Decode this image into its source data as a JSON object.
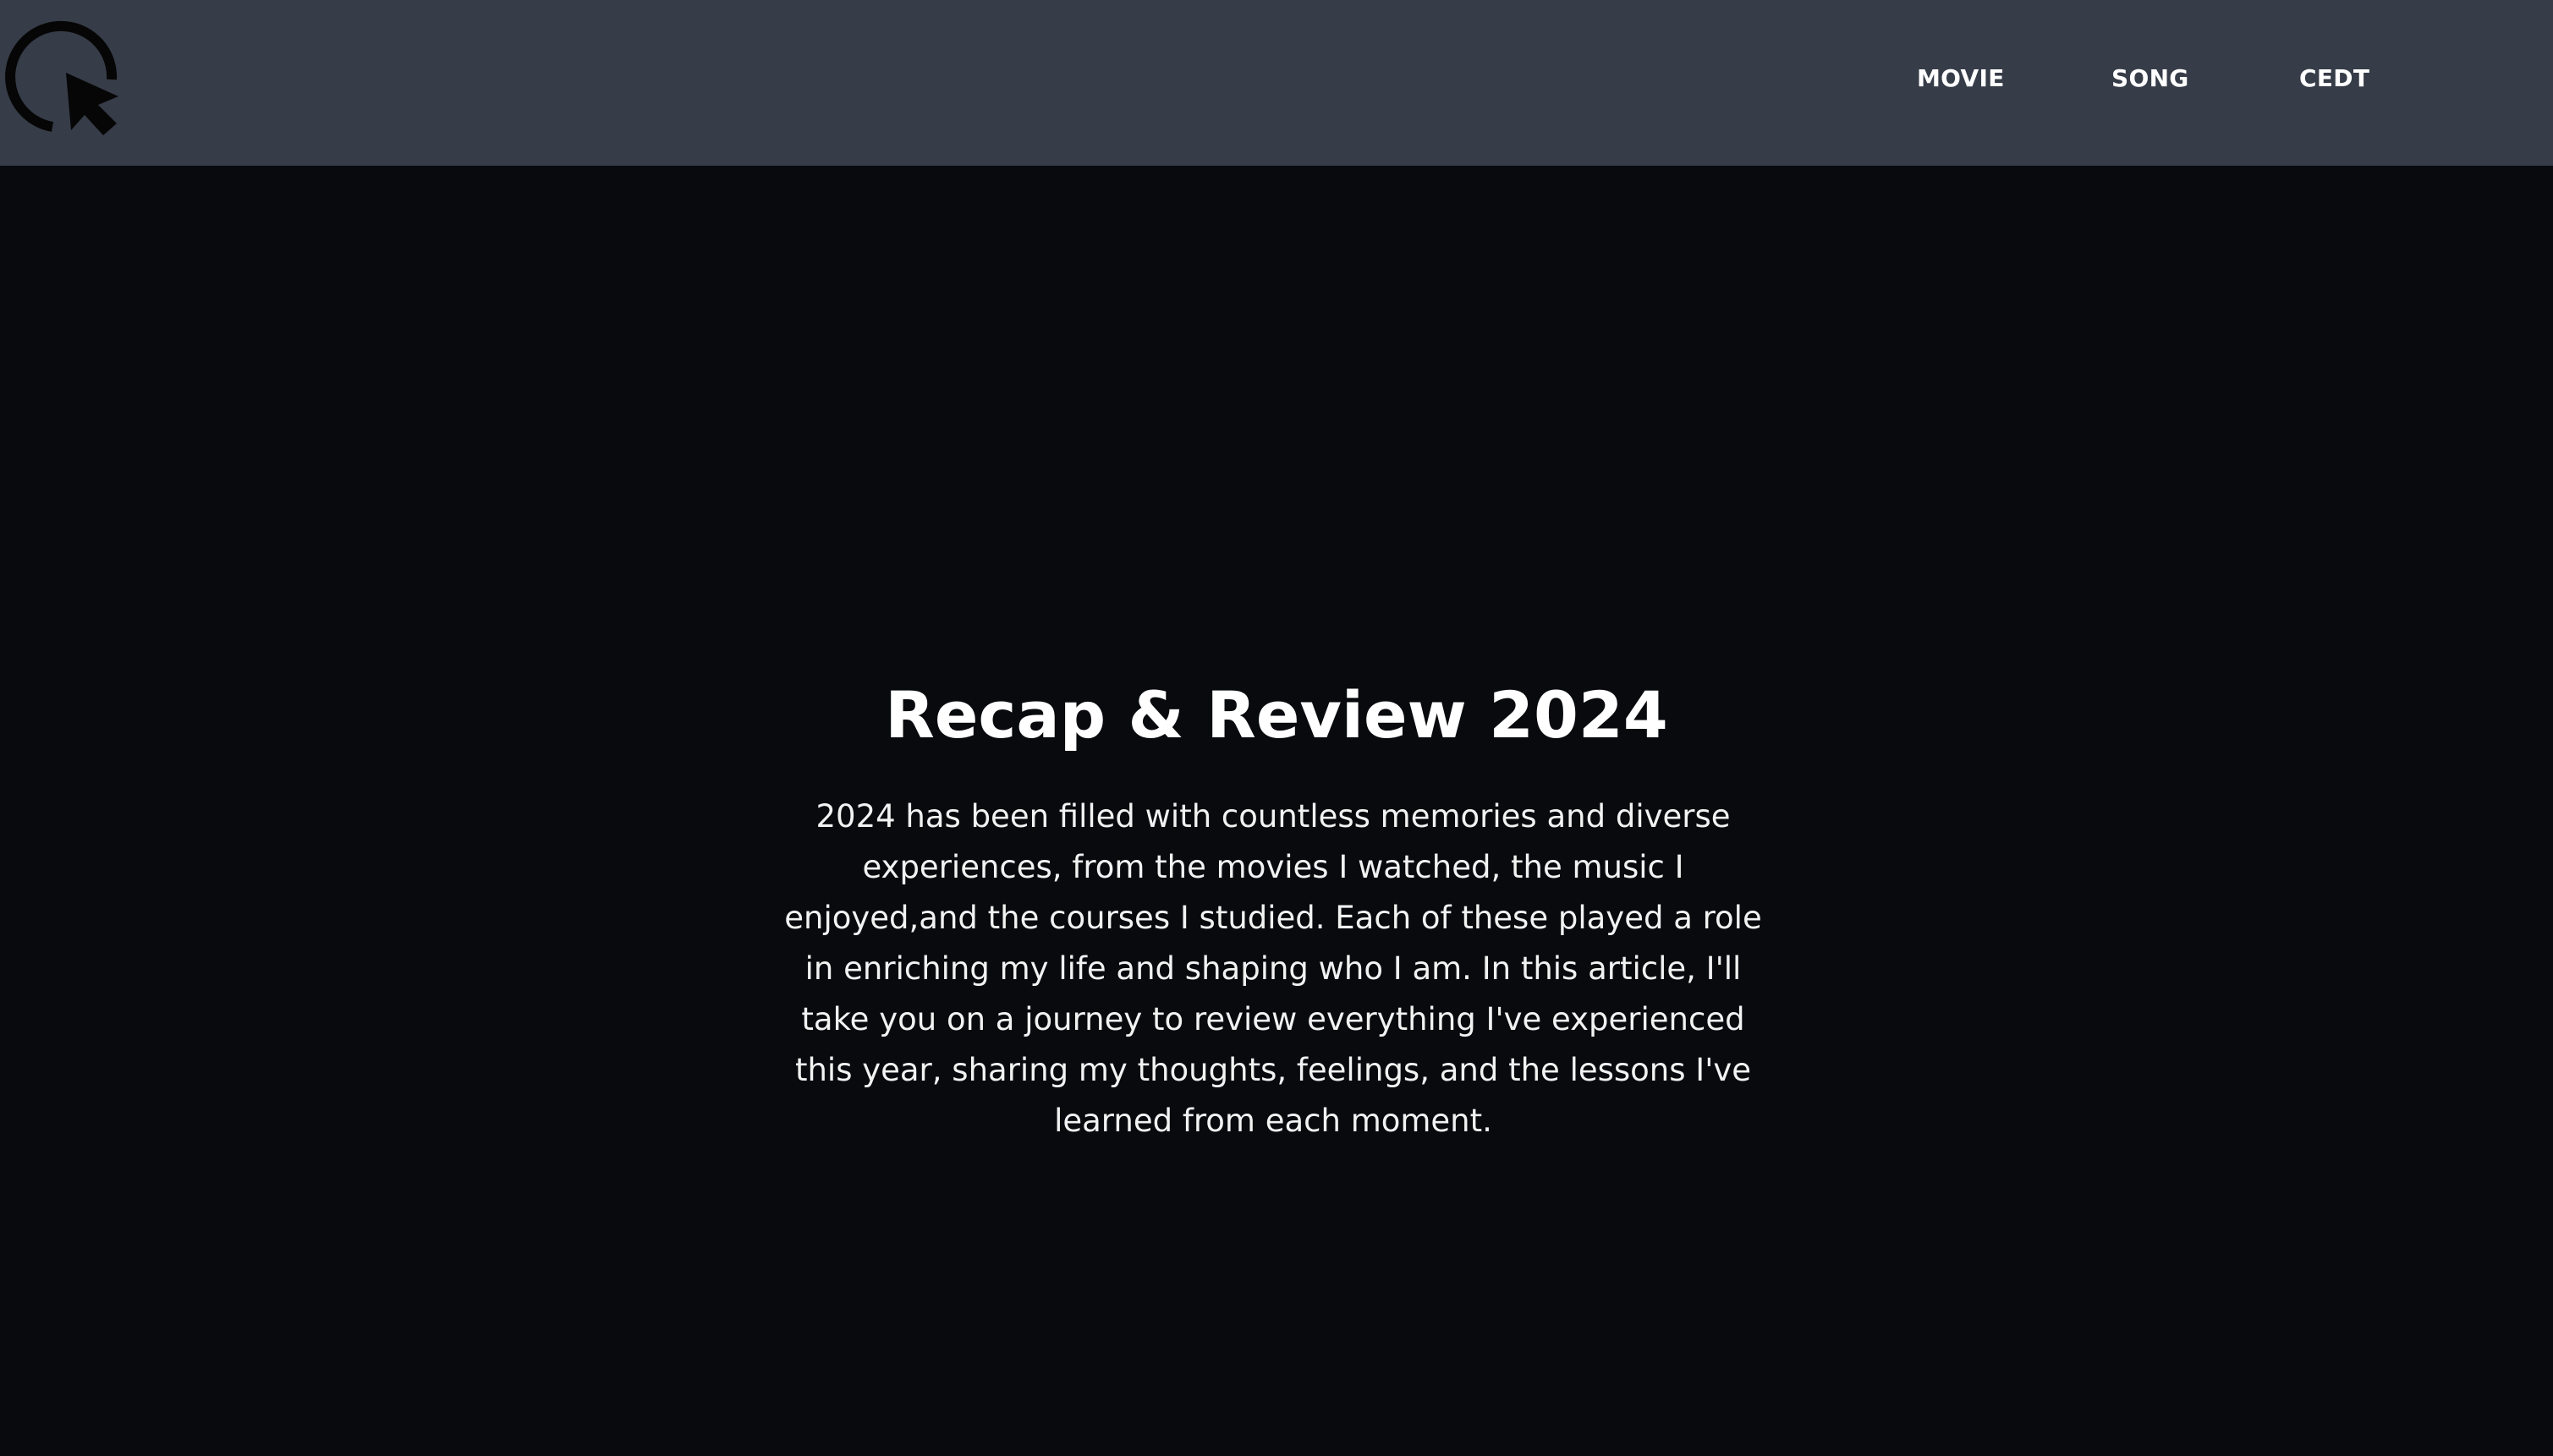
{
  "nav": {
    "logo_icon": "cursor-click-logo-icon",
    "items": [
      {
        "label": "MOVIE"
      },
      {
        "label": "SONG"
      },
      {
        "label": "CEDT"
      }
    ]
  },
  "hero": {
    "title": "Recap & Review 2024",
    "body": "2024 has been filled with countless memories and diverse experiences, from the movies I watched, the music I enjoyed,and the courses I studied. Each of these played a role in enriching my life and shaping who I am. In this article, I'll take you on a journey to review everything I've experienced this year, sharing my thoughts, feelings, and the lessons I've learned from each moment."
  },
  "colors": {
    "navbar_bg": "#363c48",
    "page_bg": "#080a0e",
    "text": "#ffffff"
  }
}
